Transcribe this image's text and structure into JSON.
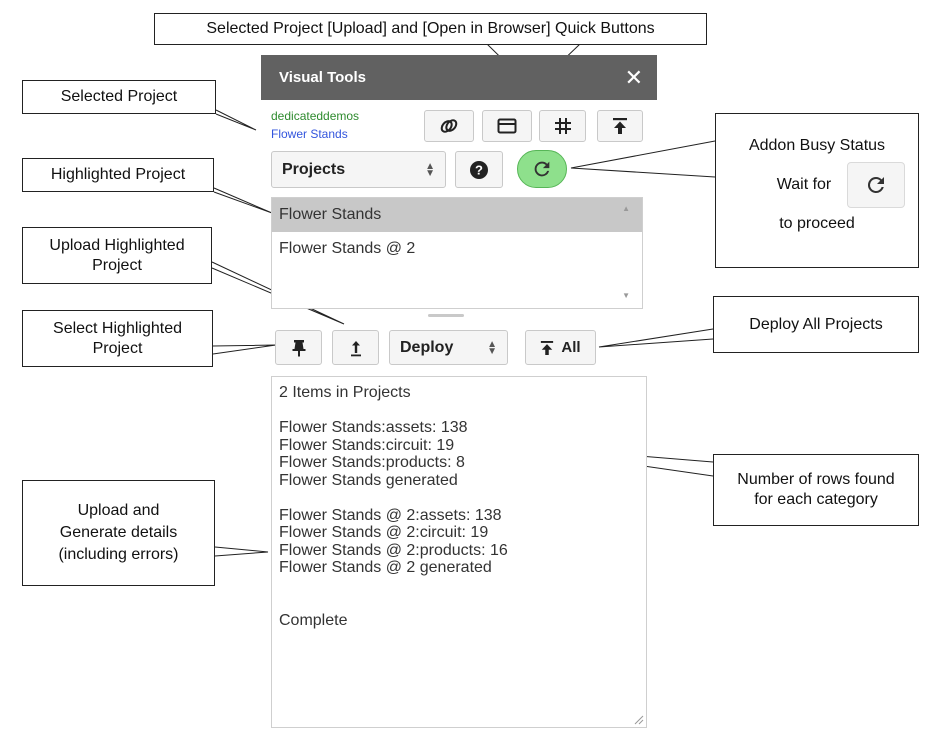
{
  "panel": {
    "title": "Visual Tools",
    "org_name": "dedicateddemos",
    "selected_project": "Flower Stands",
    "projects_select": "Projects",
    "deploy_select": "Deploy",
    "all_button_label": "All"
  },
  "project_list": {
    "items": [
      {
        "label": "Flower Stands",
        "highlighted": true
      },
      {
        "label": "Flower Stands @ 2",
        "highlighted": false
      }
    ]
  },
  "log": {
    "lines": [
      "2 Items in Projects",
      "",
      "Flower Stands:assets: 138",
      "Flower Stands:circuit: 19",
      "Flower Stands:products: 8",
      "Flower Stands generated",
      "",
      "Flower Stands @ 2:assets: 138",
      "Flower Stands @ 2:circuit: 19",
      "Flower Stands @ 2:products: 16",
      "Flower Stands @ 2 generated",
      "",
      "",
      "Complete"
    ]
  },
  "callouts": {
    "quick_buttons": "Selected Project [Upload] and [Open in Browser] Quick Buttons",
    "selected_project": "Selected Project",
    "highlighted_project": "Highlighted Project",
    "upload_highlighted": [
      "Upload Highlighted",
      "Project"
    ],
    "select_highlighted": [
      "Select Highlighted",
      "Project"
    ],
    "upload_generate": [
      "Upload and",
      "Generate details",
      "(including errors)"
    ],
    "busy_status": {
      "title": "Addon Busy Status",
      "wait_for": "Wait for",
      "to_proceed": "to proceed"
    },
    "deploy_all": "Deploy All Projects",
    "rows_found": [
      "Number of rows found",
      "for each category"
    ]
  },
  "colors": {
    "titlebar": "#616161",
    "org_text": "#2e8b2e",
    "project_text": "#3355dd",
    "busy_green": "#8ee08c",
    "highlight_row": "#c8c8c8"
  },
  "icons": {
    "toolbar": [
      "link-icon",
      "browser-window-icon",
      "grid-icon",
      "upload-icon"
    ],
    "help": "help-icon",
    "refresh": "refresh-icon",
    "pin": "pin-icon",
    "upload_small": "upload-arrow-icon",
    "upload_all": "upload-icon",
    "close": "close-icon"
  }
}
